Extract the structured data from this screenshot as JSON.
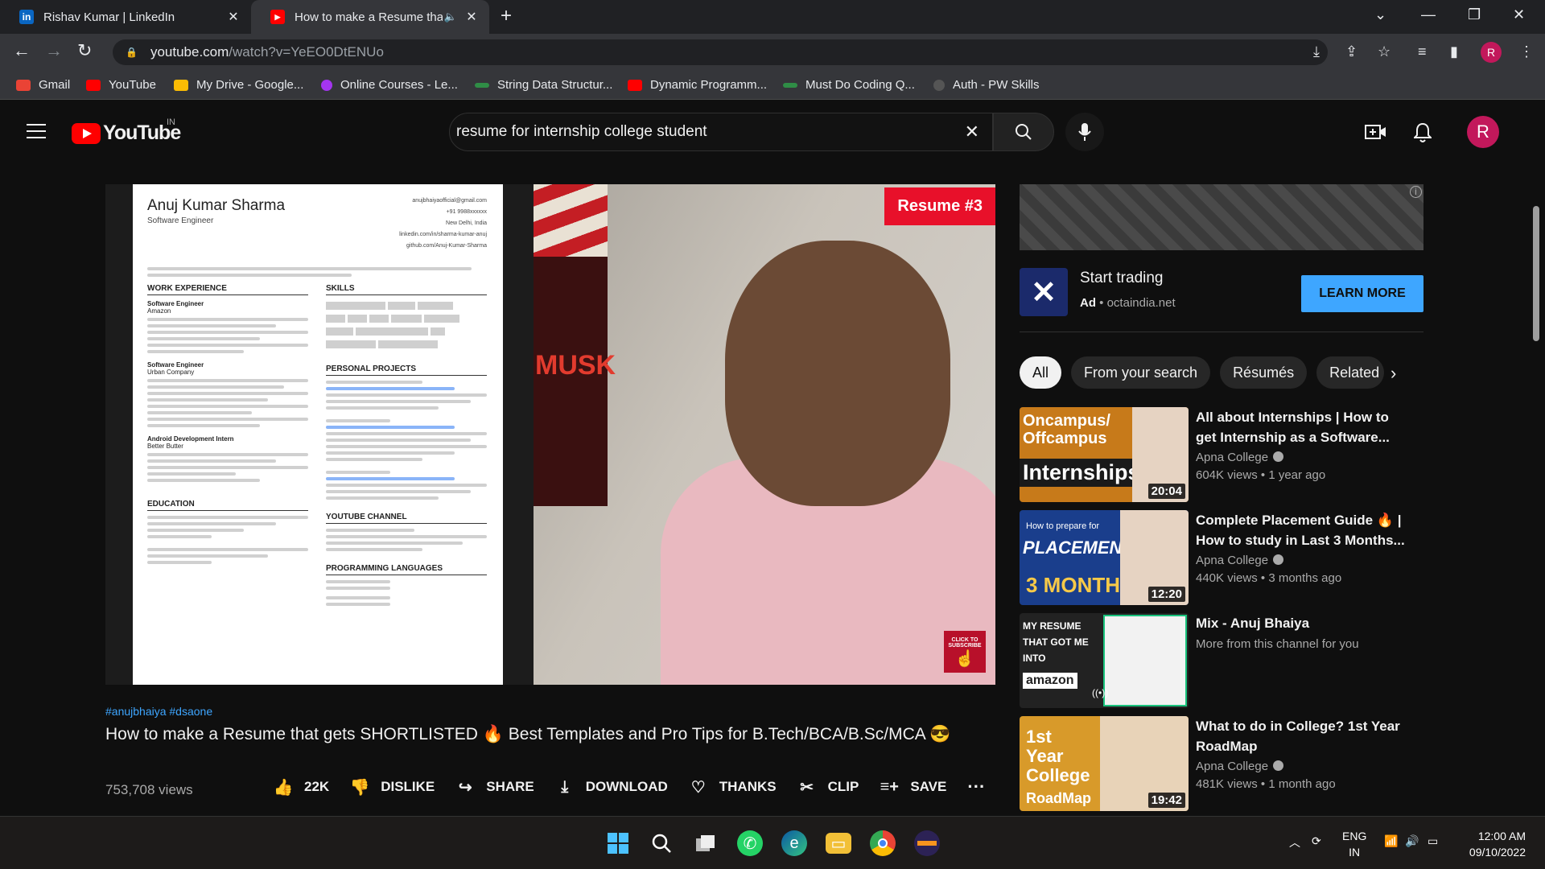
{
  "browser": {
    "tabs": [
      {
        "title": "Rishav Kumar | LinkedIn",
        "icon": "linkedin-icon"
      },
      {
        "title": "How to make a Resume that",
        "icon": "youtube-icon",
        "audio": true
      }
    ],
    "url_host": "youtube.com",
    "url_path": "/watch?v=YeEO0DtENUo",
    "profile_initial": "R",
    "bookmarks": [
      {
        "label": "Gmail",
        "color": "#ea4335"
      },
      {
        "label": "YouTube",
        "color": "#ff0000"
      },
      {
        "label": "My Drive - Google...",
        "color": "#fbbc04"
      },
      {
        "label": "Online Courses - Le...",
        "color": "#a435f0"
      },
      {
        "label": "String Data Structur...",
        "color": "#2f8d46"
      },
      {
        "label": "Dynamic Programm...",
        "color": "#ff0000"
      },
      {
        "label": "Must Do Coding Q...",
        "color": "#2f8d46"
      },
      {
        "label": "Auth - PW Skills",
        "color": "#444444"
      }
    ]
  },
  "youtube": {
    "logo_text": "YouTube",
    "country_code": "IN",
    "search_query": "resume for internship college student",
    "avatar_initial": "R",
    "video": {
      "thumb_badge": "Resume #3",
      "subscribe_text": "CLICK TO SUBSCRIBE",
      "poster_text": "MUSK",
      "resume": {
        "name": "Anuj Kumar Sharma",
        "role": "Software Engineer",
        "contact": [
          "anujbhaiyaofficial@gmail.com",
          "+91 9988xxxxxx",
          "New Delhi, India",
          "linkedin.com/in/sharma-kumar-anuj",
          "github.com/Anuj-Kumar-Sharma"
        ],
        "sections_left": [
          "WORK EXPERIENCE",
          "EDUCATION"
        ],
        "sections_right": [
          "SKILLS",
          "PERSONAL PROJECTS",
          "YOUTUBE CHANNEL",
          "PROGRAMMING LANGUAGES"
        ],
        "jobs": [
          "Software Engineer",
          "Software Engineer",
          "Android Development Intern"
        ],
        "companies": [
          "Amazon",
          "Urban Company",
          "Better Butter"
        ]
      },
      "tags": "#anujbhaiya #dsaone",
      "title": "How to make a Resume that gets SHORTLISTED 🔥 Best Templates and Pro Tips for B.Tech/BCA/B.Sc/MCA 😎",
      "views": "753,708 views",
      "actions": {
        "like": "22K",
        "dislike": "DISLIKE",
        "share": "SHARE",
        "download": "DOWNLOAD",
        "thanks": "THANKS",
        "clip": "CLIP",
        "save": "SAVE"
      }
    },
    "ad": {
      "title": "Start trading",
      "label": "Ad",
      "domain": "octaindia.net",
      "cta": "LEARN MORE"
    },
    "chips": [
      "All",
      "From your search",
      "Résumés",
      "Related"
    ],
    "recommendations": [
      {
        "title": "All about Internships | How to get Internship as a Software...",
        "channel": "Apna College",
        "verified": true,
        "views": "604K views",
        "age": "1 year ago",
        "duration": "20:04",
        "thumb_text": "Internships",
        "thumb_top": "Oncampus/ Offcampus",
        "thumb_color": "#c77a1a"
      },
      {
        "title": "Complete Placement Guide 🔥 | How to study in Last 3 Months...",
        "channel": "Apna College",
        "verified": true,
        "views": "440K views",
        "age": "3 months ago",
        "duration": "12:20",
        "thumb_text": "PLACEMENT",
        "thumb_top": "How to prepare for",
        "thumb_color": "#1a3e8c"
      },
      {
        "title": "Mix - Anuj Bhaiya",
        "channel": "More from this channel for you",
        "verified": false,
        "views": "",
        "age": "",
        "duration": "",
        "thumb_text": "amazon",
        "thumb_top": "MY RESUME THAT GOT ME INTO",
        "thumb_color": "#222222"
      },
      {
        "title": "What to do in College? 1st Year RoadMap",
        "channel": "Apna College",
        "verified": true,
        "views": "481K views",
        "age": "1 month ago",
        "duration": "19:42",
        "thumb_text": "RoadMap",
        "thumb_top": "1st Year College",
        "thumb_color": "#d89a2a"
      }
    ]
  },
  "taskbar": {
    "lang": "ENG",
    "region": "IN",
    "time": "12:00 AM",
    "date": "09/10/2022"
  }
}
